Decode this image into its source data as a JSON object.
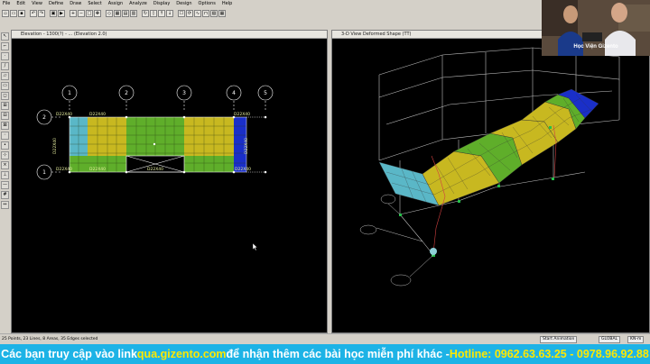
{
  "menu": [
    "File",
    "Edit",
    "View",
    "Define",
    "Draw",
    "Select",
    "Assign",
    "Analyze",
    "Display",
    "Design",
    "Options",
    "Help"
  ],
  "left_window": {
    "title": "Elevation - 1300(?) - ... (Elevation 2.0)",
    "grid_labels_x": [
      "1",
      "2",
      "3",
      "4",
      "5"
    ],
    "grid_labels_y": [
      "2",
      "1"
    ],
    "beam_labels": [
      "D22X40",
      "D22X40",
      "D22X40",
      "D22X40",
      "D22X40",
      "D22X40",
      "D22X40"
    ],
    "side_labels": [
      "D22X40",
      "D22X40"
    ]
  },
  "right_window": {
    "title": "3-D View  Deformed Shape (TT)"
  },
  "status": {
    "left_text": "25 Points, 23 Lines, 8 Areas, 35 Edges selected",
    "animation_button": "Start Animation",
    "coord_system": "GLOBAL",
    "units": "KN-m"
  },
  "webcam": {
    "label": "Học Viện Gizento"
  },
  "banner": {
    "part1": "Các bạn truy cập vào link ",
    "link": "qua.gizento.com",
    "part2": " để nhận thêm các bài học miễn phí khác - ",
    "hotline": "Hotline: 0962.63.63.25 - 0978.96.92.88"
  },
  "colors": {
    "background": "#000000",
    "slab_green": "#5fae2a",
    "slab_yellow": "#c8b820",
    "slab_cyan": "#5ab7c7",
    "slab_blue": "#1a2fc8",
    "banner": "#1db3e6",
    "banner_highlight": "#ffe800"
  }
}
